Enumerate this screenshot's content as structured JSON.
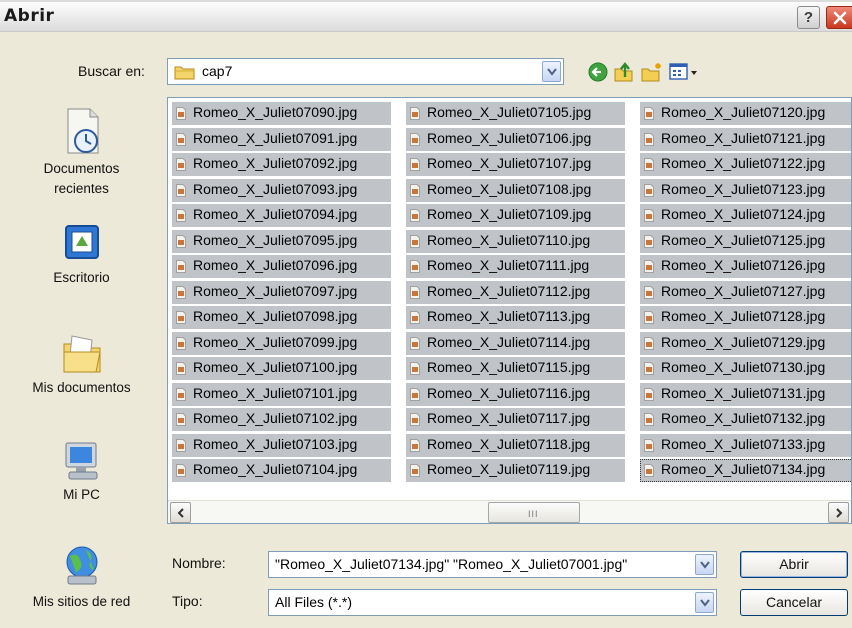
{
  "dialog": {
    "title": "Abrir",
    "help_label": "?"
  },
  "lookin": {
    "label": "Buscar en:",
    "value": "cap7"
  },
  "toolbar_icons": [
    "back-arrow-icon",
    "up-folder-icon",
    "new-folder-icon",
    "view-menu-icon"
  ],
  "places": [
    {
      "id": "recientes",
      "icon": "recent-documents-icon",
      "label": "Documentos\nrecientes"
    },
    {
      "id": "escritorio",
      "icon": "desktop-icon",
      "label": "Escritorio"
    },
    {
      "id": "mis-documentos",
      "icon": "my-documents-icon",
      "label": "Mis documentos"
    },
    {
      "id": "mi-pc",
      "icon": "my-computer-icon",
      "label": "Mi PC"
    },
    {
      "id": "red",
      "icon": "network-places-icon",
      "label": "Mis sitios de red"
    }
  ],
  "files": {
    "columns": [
      [
        "Romeo_X_Juliet07090.jpg",
        "Romeo_X_Juliet07091.jpg",
        "Romeo_X_Juliet07092.jpg",
        "Romeo_X_Juliet07093.jpg",
        "Romeo_X_Juliet07094.jpg",
        "Romeo_X_Juliet07095.jpg",
        "Romeo_X_Juliet07096.jpg",
        "Romeo_X_Juliet07097.jpg",
        "Romeo_X_Juliet07098.jpg",
        "Romeo_X_Juliet07099.jpg",
        "Romeo_X_Juliet07100.jpg",
        "Romeo_X_Juliet07101.jpg",
        "Romeo_X_Juliet07102.jpg",
        "Romeo_X_Juliet07103.jpg",
        "Romeo_X_Juliet07104.jpg"
      ],
      [
        "Romeo_X_Juliet07105.jpg",
        "Romeo_X_Juliet07106.jpg",
        "Romeo_X_Juliet07107.jpg",
        "Romeo_X_Juliet07108.jpg",
        "Romeo_X_Juliet07109.jpg",
        "Romeo_X_Juliet07110.jpg",
        "Romeo_X_Juliet07111.jpg",
        "Romeo_X_Juliet07112.jpg",
        "Romeo_X_Juliet07113.jpg",
        "Romeo_X_Juliet07114.jpg",
        "Romeo_X_Juliet07115.jpg",
        "Romeo_X_Juliet07116.jpg",
        "Romeo_X_Juliet07117.jpg",
        "Romeo_X_Juliet07118.jpg",
        "Romeo_X_Juliet07119.jpg"
      ],
      [
        "Romeo_X_Juliet07120.jpg",
        "Romeo_X_Juliet07121.jpg",
        "Romeo_X_Juliet07122.jpg",
        "Romeo_X_Juliet07123.jpg",
        "Romeo_X_Juliet07124.jpg",
        "Romeo_X_Juliet07125.jpg",
        "Romeo_X_Juliet07126.jpg",
        "Romeo_X_Juliet07127.jpg",
        "Romeo_X_Juliet07128.jpg",
        "Romeo_X_Juliet07129.jpg",
        "Romeo_X_Juliet07130.jpg",
        "Romeo_X_Juliet07131.jpg",
        "Romeo_X_Juliet07132.jpg",
        "Romeo_X_Juliet07133.jpg",
        "Romeo_X_Juliet07134.jpg"
      ]
    ],
    "focused": "Romeo_X_Juliet07134.jpg",
    "all_selected": true
  },
  "filename": {
    "label": "Nombre:",
    "value": "\"Romeo_X_Juliet07134.jpg\" \"Romeo_X_Juliet07001.jpg\""
  },
  "filetype": {
    "label": "Tipo:",
    "value": "All Files (*.*)"
  },
  "buttons": {
    "open": "Abrir",
    "cancel": "Cancelar"
  },
  "colors": {
    "selection": "#c0c4c9",
    "dialog_bg": "#ece9d8",
    "close_button": "#c9371e"
  }
}
